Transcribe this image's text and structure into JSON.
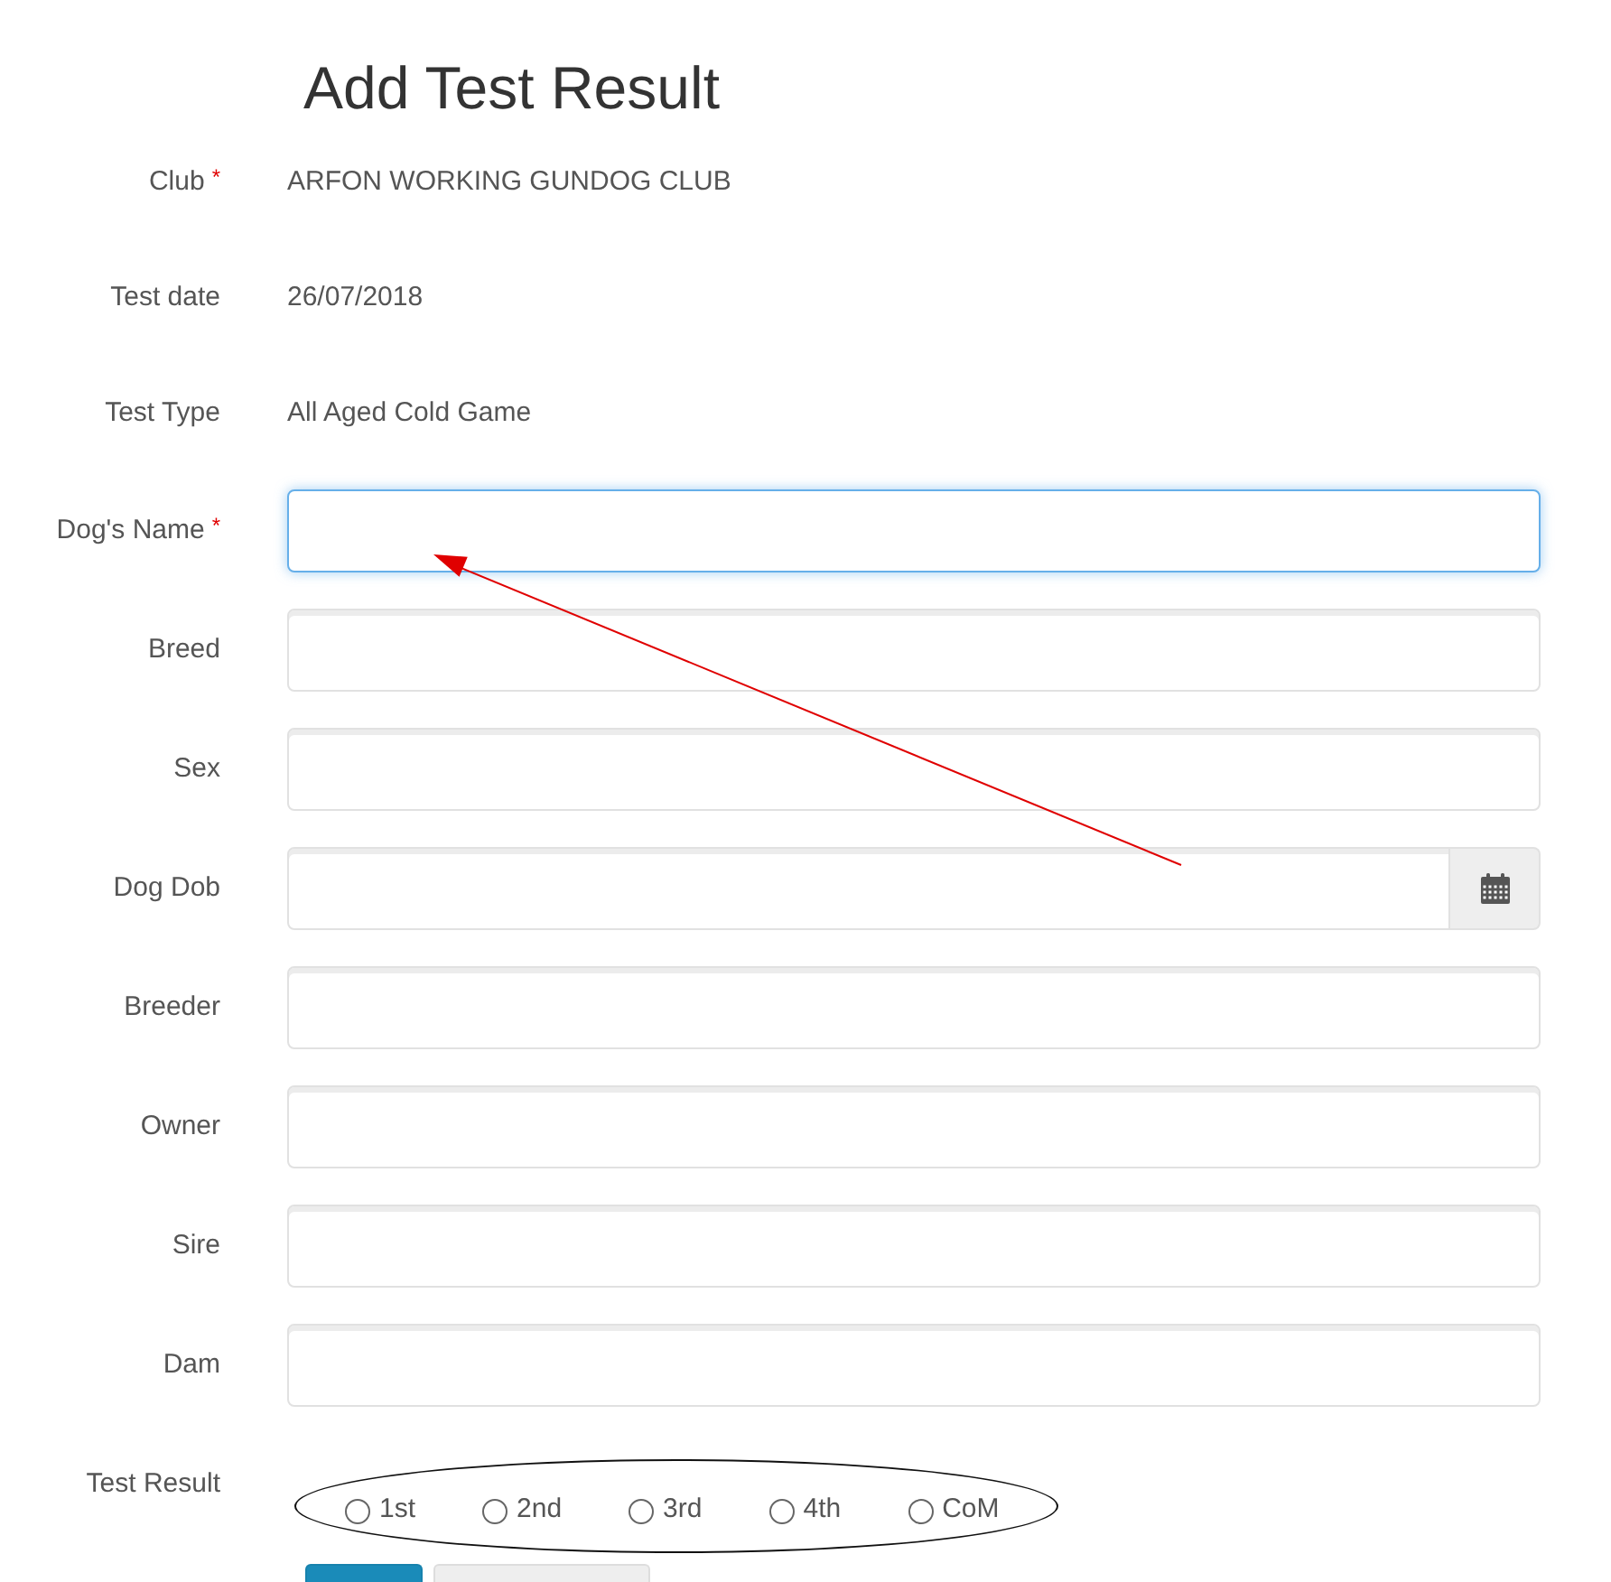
{
  "page": {
    "title": "Add Test Result"
  },
  "fields": [
    {
      "kind": "static",
      "label": "Club",
      "required_mark": "*",
      "value": "ARFON WORKING GUNDOG CLUB"
    },
    {
      "kind": "static",
      "label": "Test date",
      "value": "26/07/2018"
    },
    {
      "kind": "static",
      "label": "Test Type",
      "value": "All Aged Cold Game"
    },
    {
      "kind": "text",
      "label": "Dog's Name",
      "required_mark": "*",
      "focused": true
    },
    {
      "kind": "text",
      "label": "Breed",
      "focused": false
    },
    {
      "kind": "text",
      "label": "Sex",
      "focused": false
    },
    {
      "kind": "date",
      "label": "Dog Dob",
      "focused": false
    },
    {
      "kind": "text",
      "label": "Breeder",
      "focused": false
    },
    {
      "kind": "text",
      "label": "Owner",
      "focused": false
    },
    {
      "kind": "text",
      "label": "Sire",
      "focused": false
    },
    {
      "kind": "text",
      "label": "Dam",
      "focused": false
    },
    {
      "kind": "radio",
      "label": "Test Result",
      "circled": true,
      "options": [
        {
          "label": "1st",
          "selected": false
        },
        {
          "label": "2nd",
          "selected": false
        },
        {
          "label": "3rd",
          "selected": false
        },
        {
          "label": "4th",
          "selected": false
        },
        {
          "label": "CoM",
          "selected": false
        }
      ]
    }
  ],
  "buttons": [
    {
      "kind": "primary"
    },
    {
      "kind": "default"
    }
  ],
  "annotations": [
    {
      "kind": "arrow"
    }
  ]
}
